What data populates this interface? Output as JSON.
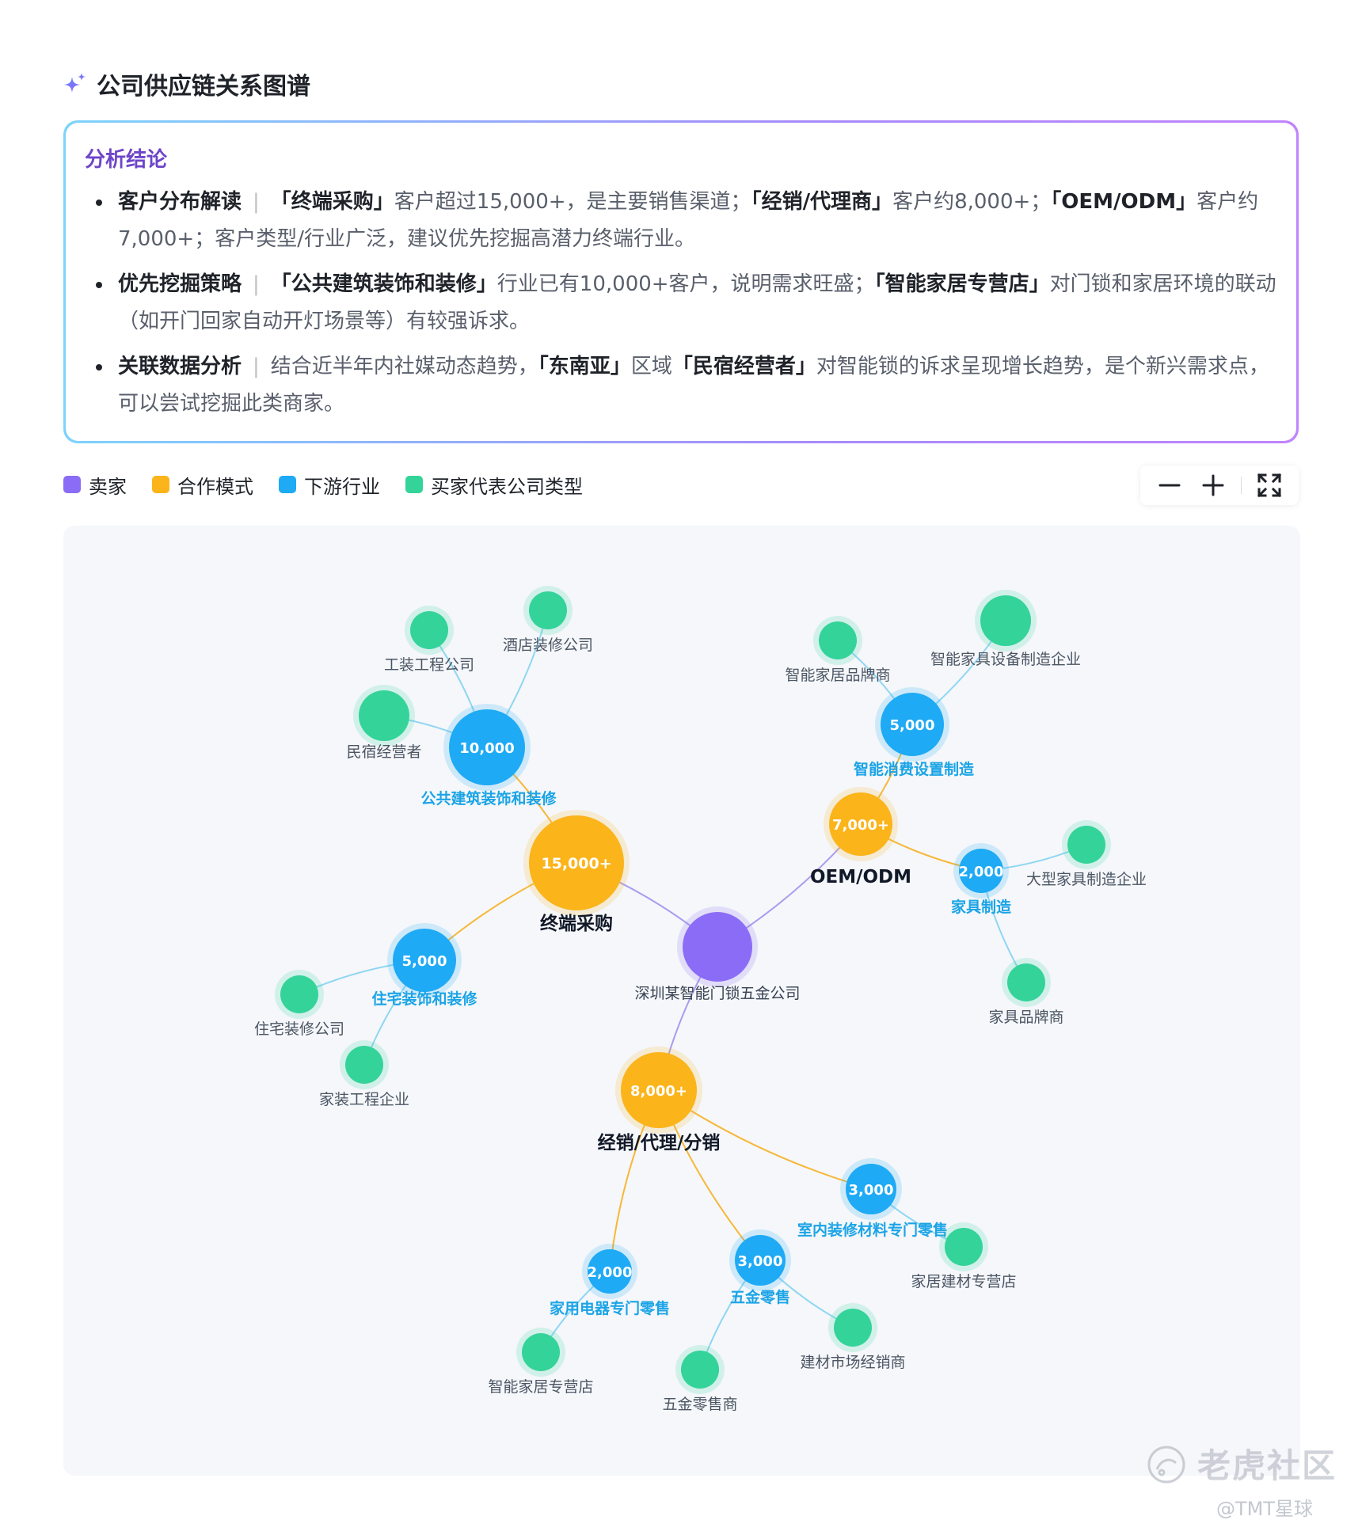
{
  "header": {
    "title": "公司供应链关系图谱"
  },
  "conclusion": {
    "title": "分析结论",
    "bullets": [
      {
        "head": "客户分布解读",
        "sep": "|",
        "segments": [
          {
            "t": "「终端采购」",
            "b": true
          },
          {
            "t": "客户超过15,000+，是主要销售渠道；",
            "b": false
          },
          {
            "t": "「经销/代理商」",
            "b": true
          },
          {
            "t": "客户约8,000+；",
            "b": false
          },
          {
            "t": "「OEM/ODM」",
            "b": true
          },
          {
            "t": "客户约7,000+；客户类型/行业广泛，建议优先挖掘高潜力终端行业。",
            "b": false
          }
        ]
      },
      {
        "head": "优先挖掘策略",
        "sep": "|",
        "segments": [
          {
            "t": "「公共建筑装饰和装修」",
            "b": true
          },
          {
            "t": "行业已有10,000+客户，说明需求旺盛；",
            "b": false
          },
          {
            "t": "「智能家居专营店」",
            "b": true
          },
          {
            "t": "对门锁和家居环境的联动（如开门回家自动开灯场景等）有较强诉求。",
            "b": false
          }
        ]
      },
      {
        "head": "关联数据分析",
        "sep": "|",
        "segments": [
          {
            "t": "结合近半年内社媒动态趋势，",
            "b": false
          },
          {
            "t": "「东南亚」",
            "b": true
          },
          {
            "t": "区域",
            "b": false
          },
          {
            "t": "「民宿经营者」",
            "b": true
          },
          {
            "t": "对智能锁的诉求呈现增长趋势，是个新兴需求点，可以尝试挖掘此类商家。",
            "b": false
          }
        ]
      }
    ]
  },
  "legend": [
    {
      "label": "卖家",
      "color": "#8b6cf6"
    },
    {
      "label": "合作模式",
      "color": "#fbb41a"
    },
    {
      "label": "下游行业",
      "color": "#1eaaf5"
    },
    {
      "label": "买家代表公司类型",
      "color": "#34d399"
    }
  ],
  "toolbar": {
    "zoom_out": "minus-icon",
    "zoom_in": "plus-icon",
    "fullscreen": "fullscreen-icon"
  },
  "graph": {
    "nodes": [
      {
        "id": "seller",
        "type": "seller",
        "label": "深圳某智能门锁五金公司"
      },
      {
        "id": "m1",
        "type": "mode",
        "label": "终端采购",
        "value": "15,000+"
      },
      {
        "id": "m2",
        "type": "mode",
        "label": "OEM/ODM",
        "value": "7,000+"
      },
      {
        "id": "m3",
        "type": "mode",
        "label": "经销/代理/分销",
        "value": "8,000+"
      },
      {
        "id": "i1",
        "type": "industry",
        "label": "公共建筑装饰和装修",
        "value": "10,000"
      },
      {
        "id": "i2",
        "type": "industry",
        "label": "住宅装饰和装修",
        "value": "5,000"
      },
      {
        "id": "i3",
        "type": "industry",
        "label": "智能消费设置制造",
        "value": "5,000"
      },
      {
        "id": "i4",
        "type": "industry",
        "label": "家具制造",
        "value": "2,000"
      },
      {
        "id": "i5",
        "type": "industry",
        "label": "室内装修材料专门零售",
        "value": "3,000"
      },
      {
        "id": "i6",
        "type": "industry",
        "label": "五金零售",
        "value": "3,000"
      },
      {
        "id": "i7",
        "type": "industry",
        "label": "家用电器专门零售",
        "value": "2,000"
      },
      {
        "id": "b1",
        "type": "buyer",
        "label": "工装工程公司"
      },
      {
        "id": "b2",
        "type": "buyer",
        "label": "酒店装修公司"
      },
      {
        "id": "b3",
        "type": "buyer",
        "label": "民宿经营者"
      },
      {
        "id": "b4",
        "type": "buyer",
        "label": "住宅装修公司"
      },
      {
        "id": "b5",
        "type": "buyer",
        "label": "家装工程企业"
      },
      {
        "id": "b6",
        "type": "buyer",
        "label": "智能家居品牌商"
      },
      {
        "id": "b7",
        "type": "buyer",
        "label": "智能家具设备制造企业"
      },
      {
        "id": "b8",
        "type": "buyer",
        "label": "大型家具制造企业"
      },
      {
        "id": "b9",
        "type": "buyer",
        "label": "家具品牌商"
      },
      {
        "id": "b10",
        "type": "buyer",
        "label": "家居建材专营店"
      },
      {
        "id": "b11",
        "type": "buyer",
        "label": "建材市场经销商"
      },
      {
        "id": "b12",
        "type": "buyer",
        "label": "五金零售商"
      },
      {
        "id": "b13",
        "type": "buyer",
        "label": "智能家居专营店"
      }
    ],
    "edges": [
      [
        "seller",
        "m1"
      ],
      [
        "seller",
        "m2"
      ],
      [
        "seller",
        "m3"
      ],
      [
        "m1",
        "i1"
      ],
      [
        "m1",
        "i2"
      ],
      [
        "m2",
        "i3"
      ],
      [
        "m2",
        "i4"
      ],
      [
        "m3",
        "i5"
      ],
      [
        "m3",
        "i6"
      ],
      [
        "m3",
        "i7"
      ],
      [
        "i1",
        "b1"
      ],
      [
        "i1",
        "b2"
      ],
      [
        "i1",
        "b3"
      ],
      [
        "i2",
        "b4"
      ],
      [
        "i2",
        "b5"
      ],
      [
        "i3",
        "b6"
      ],
      [
        "i3",
        "b7"
      ],
      [
        "i4",
        "b8"
      ],
      [
        "i4",
        "b9"
      ],
      [
        "i5",
        "b10"
      ],
      [
        "i6",
        "b11"
      ],
      [
        "i6",
        "b12"
      ],
      [
        "i7",
        "b13"
      ]
    ]
  },
  "watermark": {
    "brand": "老虎社区",
    "handle": "@TMT星球"
  }
}
